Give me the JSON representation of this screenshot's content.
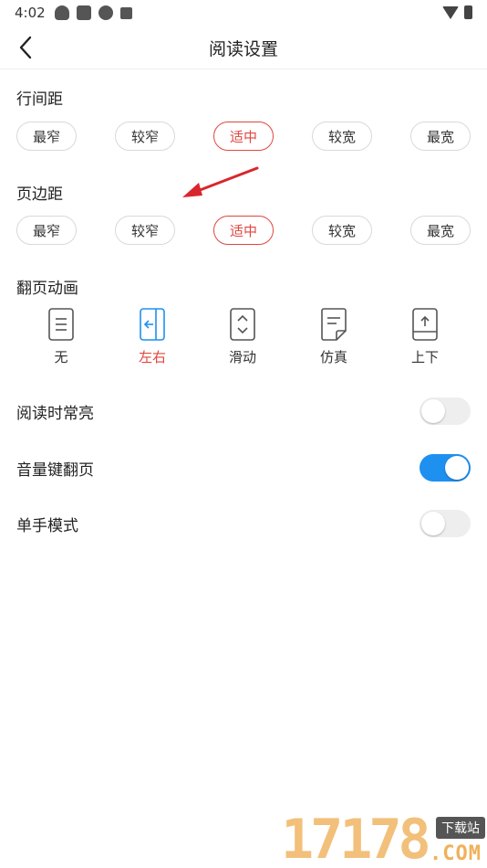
{
  "status_bar": {
    "time": "4:02",
    "left_icons": [
      "qq-icon",
      "square-icon",
      "sync-icon",
      "a-icon"
    ],
    "right_icons": [
      "wifi-icon",
      "battery-icon"
    ]
  },
  "header": {
    "title": "阅读设置",
    "back_icon": "chevron-left-icon"
  },
  "line_spacing": {
    "title": "行间距",
    "options": [
      "最窄",
      "较窄",
      "适中",
      "较宽",
      "最宽"
    ],
    "selected": "适中"
  },
  "page_margin": {
    "title": "页边距",
    "options": [
      "最窄",
      "较窄",
      "适中",
      "较宽",
      "最宽"
    ],
    "selected": "适中"
  },
  "page_animation": {
    "title": "翻页动画",
    "options": [
      "无",
      "左右",
      "滑动",
      "仿真",
      "上下"
    ],
    "selected": "左右"
  },
  "toggles": [
    {
      "label": "阅读时常亮",
      "on": false
    },
    {
      "label": "音量键翻页",
      "on": true
    },
    {
      "label": "单手模式",
      "on": false
    }
  ],
  "watermark": {
    "number": "17178",
    "tag": "下载站",
    "domain": ".COM"
  },
  "colors": {
    "accent_red": "#e0463f",
    "accent_blue": "#1e90f0",
    "annotation_arrow": "#d9262c"
  }
}
